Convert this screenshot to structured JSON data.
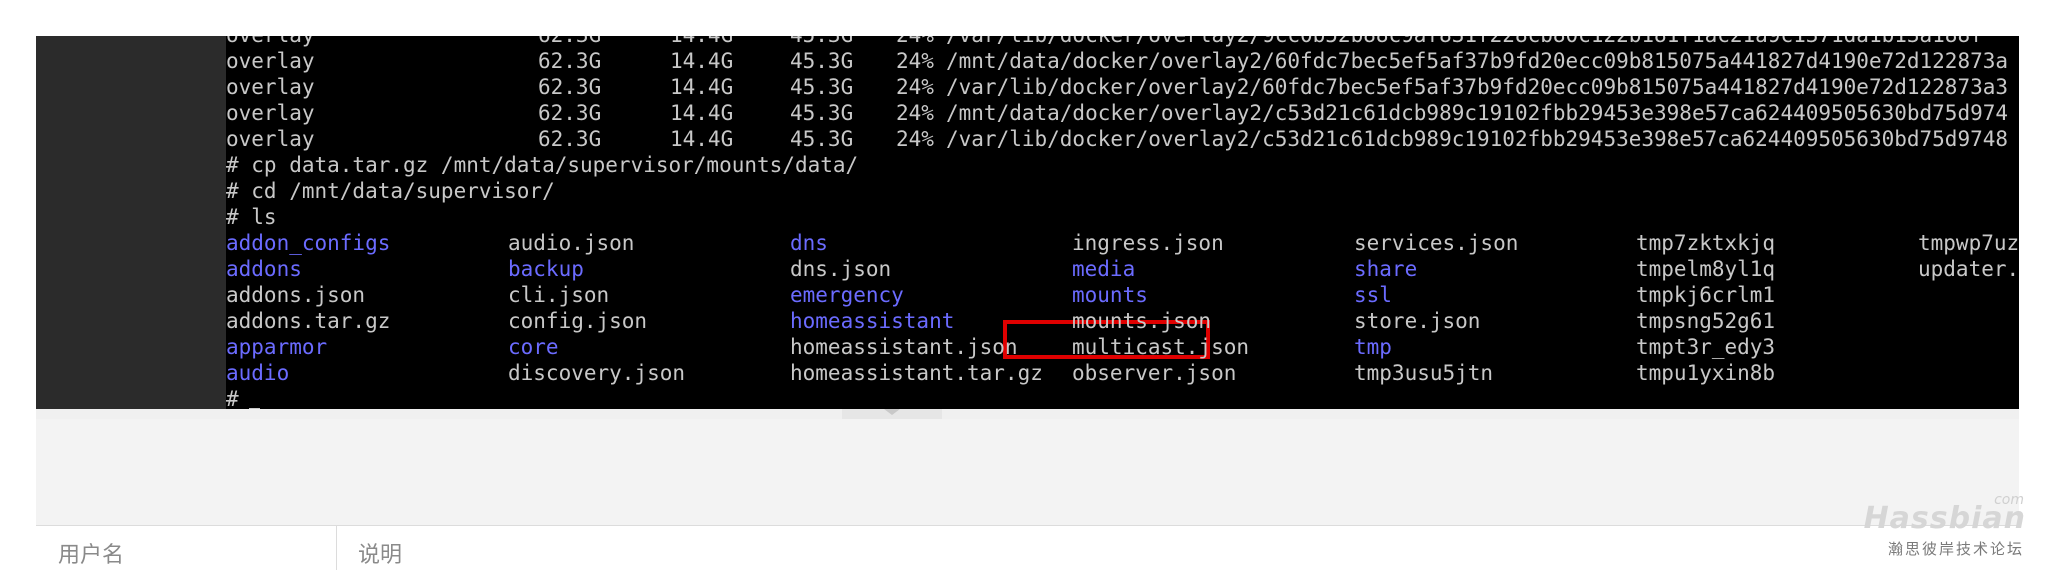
{
  "terminal": {
    "df_rows": [
      {
        "fs": "overlay",
        "size": "62.3G",
        "used": "14.4G",
        "avail": "45.3G",
        "use": "24%",
        "mount": "/var/lib/docker/overlay2/9cc0b52b88c9af831f228cb80c122b181f1ac21a9c1371da1b13a188f"
      },
      {
        "fs": "overlay",
        "size": "62.3G",
        "used": "14.4G",
        "avail": "45.3G",
        "use": "24%",
        "mount": "/mnt/data/docker/overlay2/60fdc7bec5ef5af37b9fd20ecc09b815075a441827d4190e72d122873a"
      },
      {
        "fs": "overlay",
        "size": "62.3G",
        "used": "14.4G",
        "avail": "45.3G",
        "use": "24%",
        "mount": "/var/lib/docker/overlay2/60fdc7bec5ef5af37b9fd20ecc09b815075a441827d4190e72d122873a3"
      },
      {
        "fs": "overlay",
        "size": "62.3G",
        "used": "14.4G",
        "avail": "45.3G",
        "use": "24%",
        "mount": "/mnt/data/docker/overlay2/c53d21c61dcb989c19102fbb29453e398e57ca624409505630bd75d974"
      },
      {
        "fs": "overlay",
        "size": "62.3G",
        "used": "14.4G",
        "avail": "45.3G",
        "use": "24%",
        "mount": "/var/lib/docker/overlay2/c53d21c61dcb989c19102fbb29453e398e57ca624409505630bd75d9748"
      }
    ],
    "commands": [
      "# cp data.tar.gz /mnt/data/supervisor/mounts/data/",
      "# cd /mnt/data/supervisor/",
      "# ls"
    ],
    "ls_rows": [
      [
        {
          "name": "addon_configs",
          "dir": true
        },
        {
          "name": "audio.json",
          "dir": false
        },
        {
          "name": "dns",
          "dir": true
        },
        {
          "name": "ingress.json",
          "dir": false
        },
        {
          "name": "services.json",
          "dir": false
        },
        {
          "name": "tmp7zktxkjq",
          "dir": false
        },
        {
          "name": "tmpwp7uz",
          "dir": false
        }
      ],
      [
        {
          "name": "addons",
          "dir": true
        },
        {
          "name": "backup",
          "dir": true
        },
        {
          "name": "dns.json",
          "dir": false
        },
        {
          "name": "media",
          "dir": true
        },
        {
          "name": "share",
          "dir": true
        },
        {
          "name": "tmpelm8yl1q",
          "dir": false
        },
        {
          "name": "updater.",
          "dir": false
        }
      ],
      [
        {
          "name": "addons.json",
          "dir": false
        },
        {
          "name": "cli.json",
          "dir": false
        },
        {
          "name": "emergency",
          "dir": true
        },
        {
          "name": "mounts",
          "dir": true
        },
        {
          "name": "ssl",
          "dir": true
        },
        {
          "name": "tmpkj6crlm1",
          "dir": false
        },
        {
          "name": "",
          "dir": false
        }
      ],
      [
        {
          "name": "addons.tar.gz",
          "dir": false
        },
        {
          "name": "config.json",
          "dir": false
        },
        {
          "name": "homeassistant",
          "dir": true
        },
        {
          "name": "mounts.json",
          "dir": false
        },
        {
          "name": "store.json",
          "dir": false
        },
        {
          "name": "tmpsng52g61",
          "dir": false
        },
        {
          "name": "",
          "dir": false
        }
      ],
      [
        {
          "name": "apparmor",
          "dir": true
        },
        {
          "name": "core",
          "dir": true
        },
        {
          "name": "homeassistant.json",
          "dir": false
        },
        {
          "name": "multicast.json",
          "dir": false
        },
        {
          "name": "tmp",
          "dir": true
        },
        {
          "name": "tmpt3r_edy3",
          "dir": false
        },
        {
          "name": "",
          "dir": false
        }
      ],
      [
        {
          "name": "audio",
          "dir": true
        },
        {
          "name": "discovery.json",
          "dir": false
        },
        {
          "name": "homeassistant.tar.gz",
          "dir": false
        },
        {
          "name": "observer.json",
          "dir": false
        },
        {
          "name": "tmp3usu5jtn",
          "dir": false
        },
        {
          "name": "tmpu1yxin8b",
          "dir": false
        },
        {
          "name": "",
          "dir": false
        }
      ]
    ],
    "prompt": "#",
    "colors": {
      "background": "#000000",
      "text": "#c8c8c8",
      "directory": "#6b6bff",
      "highlight": "#e00000"
    }
  },
  "table": {
    "columns": [
      "用户名",
      "说明"
    ]
  },
  "watermark": {
    "brand": "Hassbian",
    "suffix": "com",
    "subtitle": "瀚思彼岸技术论坛"
  }
}
